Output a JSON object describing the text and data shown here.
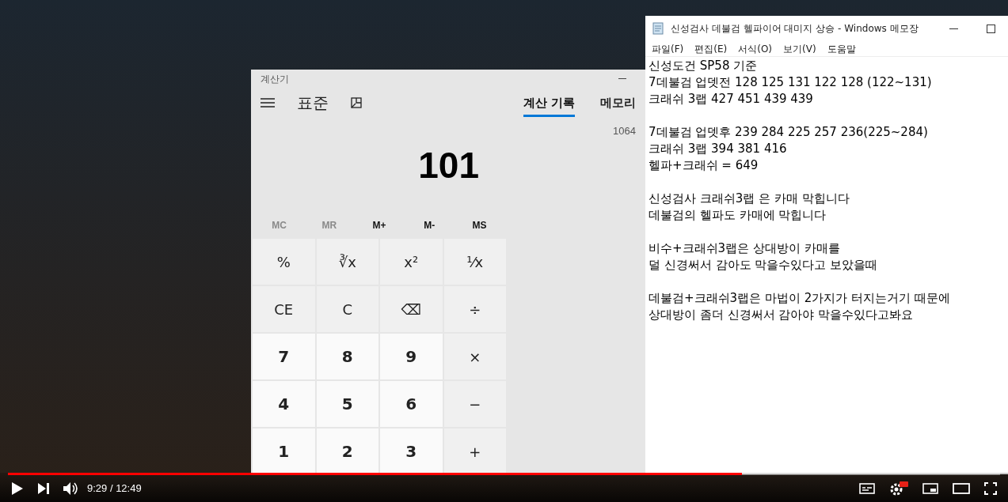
{
  "calculator": {
    "title": "계산기",
    "mode": "표준",
    "history_tabs": [
      {
        "label": "계산 기록",
        "selected": true
      },
      {
        "label": "메모리",
        "selected": false
      }
    ],
    "history": [
      "1064"
    ],
    "display": "101",
    "memory_buttons": [
      {
        "label": "MC",
        "disabled": true
      },
      {
        "label": "MR",
        "disabled": true
      },
      {
        "label": "M+",
        "disabled": false
      },
      {
        "label": "M-",
        "disabled": false
      },
      {
        "label": "MS",
        "disabled": false
      }
    ],
    "keys": [
      {
        "label": "%",
        "kind": "op"
      },
      {
        "label": "∛x",
        "kind": "op"
      },
      {
        "label": "x²",
        "kind": "op"
      },
      {
        "label": "¹⁄x",
        "kind": "op"
      },
      {
        "label": "CE",
        "kind": "op"
      },
      {
        "label": "C",
        "kind": "op"
      },
      {
        "label": "⌫",
        "kind": "op"
      },
      {
        "label": "÷",
        "kind": "op"
      },
      {
        "label": "7",
        "kind": "digit"
      },
      {
        "label": "8",
        "kind": "digit"
      },
      {
        "label": "9",
        "kind": "digit"
      },
      {
        "label": "×",
        "kind": "op"
      },
      {
        "label": "4",
        "kind": "digit"
      },
      {
        "label": "5",
        "kind": "digit"
      },
      {
        "label": "6",
        "kind": "digit"
      },
      {
        "label": "−",
        "kind": "op"
      },
      {
        "label": "1",
        "kind": "digit"
      },
      {
        "label": "2",
        "kind": "digit"
      },
      {
        "label": "3",
        "kind": "digit"
      },
      {
        "label": "+",
        "kind": "op"
      }
    ]
  },
  "notepad": {
    "title": "신성검사 데불검 헬파이어 대미지 상승 - Windows 메모장",
    "menu": [
      "파일(F)",
      "편집(E)",
      "서식(O)",
      "보기(V)",
      "도움말"
    ],
    "paragraphs": [
      [
        "신성도건 SP58 기준",
        "7데불검 업뎃전 128 125 131 122 128 (122~131)",
        "크래쉬 3랩 427 451 439 439"
      ],
      [
        "7데불검 업뎃후 239 284 225 257 236(225~284)",
        "크래쉬 3랩 394 381 416",
        "헬파+크래쉬 = 649"
      ],
      [
        "신성검사 크래쉬3랩 은 카매 막힙니다",
        "데불검의 헬파도 카매에 막힙니다"
      ],
      [
        "비수+크래쉬3랩은 상대방이 카매를",
        "덜 신경써서 감아도 막을수있다고 보았을때"
      ],
      [
        "데불검+크래쉬3랩은 마법이 2가지가 터지는거기 때문에",
        "상대방이 좀더 신경써서 감아야 막을수있다고봐요"
      ]
    ]
  },
  "player": {
    "progress": {
      "level": 0.74
    },
    "time": "9:29 / 12:49"
  }
}
